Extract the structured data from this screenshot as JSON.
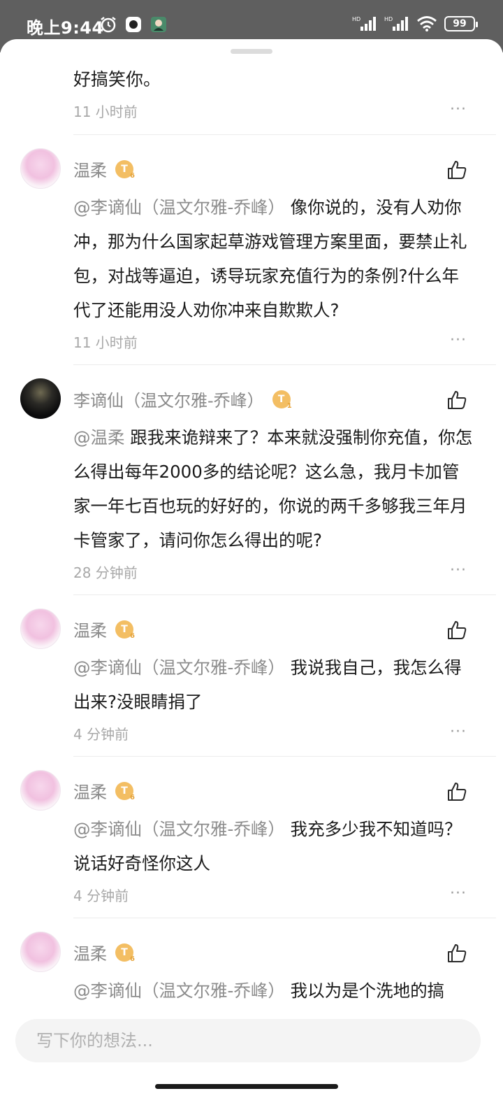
{
  "status_bar": {
    "time": "晚上9:44",
    "battery": "99"
  },
  "top_fragment": {
    "text": "好搞笑你。",
    "time": "11 小时前"
  },
  "comments": [
    {
      "name": "温柔",
      "badge": "T",
      "badge_num": "6",
      "mention": "@李谪仙（温文尔雅-乔峰）",
      "text": "像你说的，没有人劝你冲，那为什么国家起草游戏管理方案里面，要禁止礼包，对战等逼迫，诱导玩家充值行为的条例?什么年代了还能用没人劝你冲来自欺欺人?",
      "time": "11 小时前"
    },
    {
      "name": "李谪仙（温文尔雅-乔峰）",
      "badge": "T",
      "badge_num": "1",
      "mention": "@温柔",
      "text": "跟我来诡辩来了？本来就没强制你充值，你怎么得出每年2000多的结论呢？这么急，我月卡加管家一年七百也玩的好好的，你说的两千多够我三年月卡管家了，请问你怎么得出的呢?",
      "time": "28 分钟前"
    },
    {
      "name": "温柔",
      "badge": "T",
      "badge_num": "6",
      "mention": "@李谪仙（温文尔雅-乔峰）",
      "text": "我说我自己，我怎么得出来?没眼睛捐了",
      "time": "4 分钟前"
    },
    {
      "name": "温柔",
      "badge": "T",
      "badge_num": "6",
      "mention": "@李谪仙（温文尔雅-乔峰）",
      "text": "我充多少我不知道吗？说话好奇怪你这人",
      "time": "4 分钟前"
    },
    {
      "name": "温柔",
      "badge": "T",
      "badge_num": "6",
      "mention": "@李谪仙（温文尔雅-乔峰）",
      "text": "我以为是个洗地的搞",
      "time": ""
    }
  ],
  "more_label": "···",
  "input": {
    "placeholder": "写下你的想法..."
  }
}
